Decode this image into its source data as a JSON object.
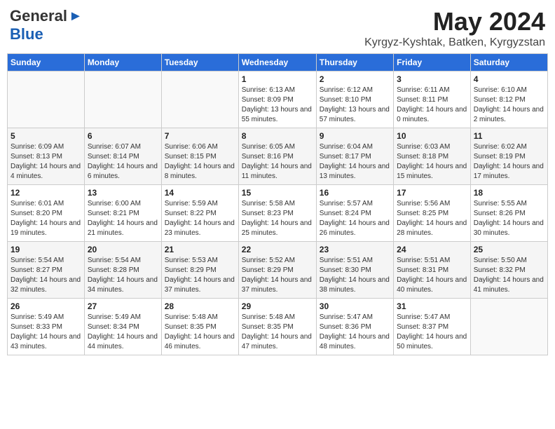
{
  "header": {
    "logo_general": "General",
    "logo_blue": "Blue",
    "title": "May 2024",
    "location": "Kyrgyz-Kyshtak, Batken, Kyrgyzstan"
  },
  "weekdays": [
    "Sunday",
    "Monday",
    "Tuesday",
    "Wednesday",
    "Thursday",
    "Friday",
    "Saturday"
  ],
  "weeks": [
    [
      {
        "day": "",
        "sunrise": "",
        "sunset": "",
        "daylight": ""
      },
      {
        "day": "",
        "sunrise": "",
        "sunset": "",
        "daylight": ""
      },
      {
        "day": "",
        "sunrise": "",
        "sunset": "",
        "daylight": ""
      },
      {
        "day": "1",
        "sunrise": "Sunrise: 6:13 AM",
        "sunset": "Sunset: 8:09 PM",
        "daylight": "Daylight: 13 hours and 55 minutes."
      },
      {
        "day": "2",
        "sunrise": "Sunrise: 6:12 AM",
        "sunset": "Sunset: 8:10 PM",
        "daylight": "Daylight: 13 hours and 57 minutes."
      },
      {
        "day": "3",
        "sunrise": "Sunrise: 6:11 AM",
        "sunset": "Sunset: 8:11 PM",
        "daylight": "Daylight: 14 hours and 0 minutes."
      },
      {
        "day": "4",
        "sunrise": "Sunrise: 6:10 AM",
        "sunset": "Sunset: 8:12 PM",
        "daylight": "Daylight: 14 hours and 2 minutes."
      }
    ],
    [
      {
        "day": "5",
        "sunrise": "Sunrise: 6:09 AM",
        "sunset": "Sunset: 8:13 PM",
        "daylight": "Daylight: 14 hours and 4 minutes."
      },
      {
        "day": "6",
        "sunrise": "Sunrise: 6:07 AM",
        "sunset": "Sunset: 8:14 PM",
        "daylight": "Daylight: 14 hours and 6 minutes."
      },
      {
        "day": "7",
        "sunrise": "Sunrise: 6:06 AM",
        "sunset": "Sunset: 8:15 PM",
        "daylight": "Daylight: 14 hours and 8 minutes."
      },
      {
        "day": "8",
        "sunrise": "Sunrise: 6:05 AM",
        "sunset": "Sunset: 8:16 PM",
        "daylight": "Daylight: 14 hours and 11 minutes."
      },
      {
        "day": "9",
        "sunrise": "Sunrise: 6:04 AM",
        "sunset": "Sunset: 8:17 PM",
        "daylight": "Daylight: 14 hours and 13 minutes."
      },
      {
        "day": "10",
        "sunrise": "Sunrise: 6:03 AM",
        "sunset": "Sunset: 8:18 PM",
        "daylight": "Daylight: 14 hours and 15 minutes."
      },
      {
        "day": "11",
        "sunrise": "Sunrise: 6:02 AM",
        "sunset": "Sunset: 8:19 PM",
        "daylight": "Daylight: 14 hours and 17 minutes."
      }
    ],
    [
      {
        "day": "12",
        "sunrise": "Sunrise: 6:01 AM",
        "sunset": "Sunset: 8:20 PM",
        "daylight": "Daylight: 14 hours and 19 minutes."
      },
      {
        "day": "13",
        "sunrise": "Sunrise: 6:00 AM",
        "sunset": "Sunset: 8:21 PM",
        "daylight": "Daylight: 14 hours and 21 minutes."
      },
      {
        "day": "14",
        "sunrise": "Sunrise: 5:59 AM",
        "sunset": "Sunset: 8:22 PM",
        "daylight": "Daylight: 14 hours and 23 minutes."
      },
      {
        "day": "15",
        "sunrise": "Sunrise: 5:58 AM",
        "sunset": "Sunset: 8:23 PM",
        "daylight": "Daylight: 14 hours and 25 minutes."
      },
      {
        "day": "16",
        "sunrise": "Sunrise: 5:57 AM",
        "sunset": "Sunset: 8:24 PM",
        "daylight": "Daylight: 14 hours and 26 minutes."
      },
      {
        "day": "17",
        "sunrise": "Sunrise: 5:56 AM",
        "sunset": "Sunset: 8:25 PM",
        "daylight": "Daylight: 14 hours and 28 minutes."
      },
      {
        "day": "18",
        "sunrise": "Sunrise: 5:55 AM",
        "sunset": "Sunset: 8:26 PM",
        "daylight": "Daylight: 14 hours and 30 minutes."
      }
    ],
    [
      {
        "day": "19",
        "sunrise": "Sunrise: 5:54 AM",
        "sunset": "Sunset: 8:27 PM",
        "daylight": "Daylight: 14 hours and 32 minutes."
      },
      {
        "day": "20",
        "sunrise": "Sunrise: 5:54 AM",
        "sunset": "Sunset: 8:28 PM",
        "daylight": "Daylight: 14 hours and 34 minutes."
      },
      {
        "day": "21",
        "sunrise": "Sunrise: 5:53 AM",
        "sunset": "Sunset: 8:29 PM",
        "daylight": "Daylight: 14 hours and 37 minutes."
      },
      {
        "day": "22",
        "sunrise": "Sunrise: 5:52 AM",
        "sunset": "Sunset: 8:29 PM",
        "daylight": "Daylight: 14 hours and 37 minutes."
      },
      {
        "day": "23",
        "sunrise": "Sunrise: 5:51 AM",
        "sunset": "Sunset: 8:30 PM",
        "daylight": "Daylight: 14 hours and 38 minutes."
      },
      {
        "day": "24",
        "sunrise": "Sunrise: 5:51 AM",
        "sunset": "Sunset: 8:31 PM",
        "daylight": "Daylight: 14 hours and 40 minutes."
      },
      {
        "day": "25",
        "sunrise": "Sunrise: 5:50 AM",
        "sunset": "Sunset: 8:32 PM",
        "daylight": "Daylight: 14 hours and 41 minutes."
      }
    ],
    [
      {
        "day": "26",
        "sunrise": "Sunrise: 5:49 AM",
        "sunset": "Sunset: 8:33 PM",
        "daylight": "Daylight: 14 hours and 43 minutes."
      },
      {
        "day": "27",
        "sunrise": "Sunrise: 5:49 AM",
        "sunset": "Sunset: 8:34 PM",
        "daylight": "Daylight: 14 hours and 44 minutes."
      },
      {
        "day": "28",
        "sunrise": "Sunrise: 5:48 AM",
        "sunset": "Sunset: 8:35 PM",
        "daylight": "Daylight: 14 hours and 46 minutes."
      },
      {
        "day": "29",
        "sunrise": "Sunrise: 5:48 AM",
        "sunset": "Sunset: 8:35 PM",
        "daylight": "Daylight: 14 hours and 47 minutes."
      },
      {
        "day": "30",
        "sunrise": "Sunrise: 5:47 AM",
        "sunset": "Sunset: 8:36 PM",
        "daylight": "Daylight: 14 hours and 48 minutes."
      },
      {
        "day": "31",
        "sunrise": "Sunrise: 5:47 AM",
        "sunset": "Sunset: 8:37 PM",
        "daylight": "Daylight: 14 hours and 50 minutes."
      },
      {
        "day": "",
        "sunrise": "",
        "sunset": "",
        "daylight": ""
      }
    ]
  ]
}
